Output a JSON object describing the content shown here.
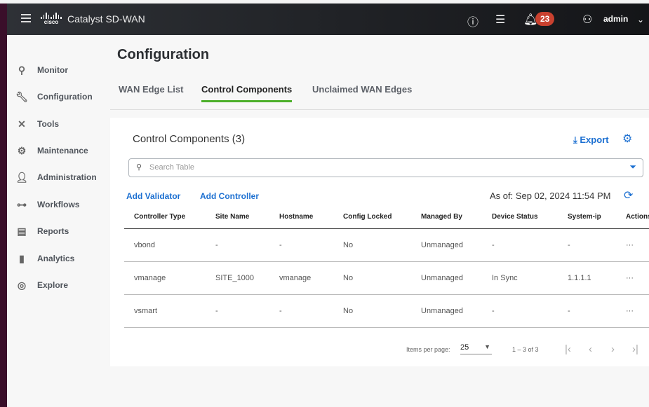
{
  "header": {
    "app_title": "Catalyst SD-WAN",
    "logo_text": "cisco",
    "notification_count": "23",
    "user": "admin"
  },
  "sidebar": {
    "items": [
      {
        "label": "Monitor",
        "icon": "monitor-icon"
      },
      {
        "label": "Configuration",
        "icon": "wrench-icon"
      },
      {
        "label": "Tools",
        "icon": "tools-icon"
      },
      {
        "label": "Maintenance",
        "icon": "maintenance-icon"
      },
      {
        "label": "Administration",
        "icon": "admin-icon"
      },
      {
        "label": "Workflows",
        "icon": "workflow-icon"
      },
      {
        "label": "Reports",
        "icon": "report-icon"
      },
      {
        "label": "Analytics",
        "icon": "analytics-icon"
      },
      {
        "label": "Explore",
        "icon": "compass-icon"
      }
    ]
  },
  "page": {
    "title": "Configuration",
    "tabs": [
      "WAN Edge List",
      "Control Components",
      "Unclaimed WAN Edges"
    ],
    "active_tab": "Control Components"
  },
  "card": {
    "title": "Control Components (3)",
    "export": "Export",
    "search_placeholder": "Search Table",
    "add_validator": "Add Validator",
    "add_controller": "Add Controller",
    "as_of": "As of: Sep 02, 2024 11:54 PM"
  },
  "table": {
    "columns": [
      "Controller Type",
      "Site Name",
      "Hostname",
      "Config Locked",
      "Managed By",
      "Device Status",
      "System-ip",
      "Actions"
    ],
    "rows": [
      [
        "vbond",
        "-",
        "-",
        "No",
        "Unmanaged",
        "-",
        "-",
        "···"
      ],
      [
        "vmanage",
        "SITE_1000",
        "vmanage",
        "No",
        "Unmanaged",
        "In Sync",
        "1.1.1.1",
        "···"
      ],
      [
        "vsmart",
        "-",
        "-",
        "No",
        "Unmanaged",
        "-",
        "-",
        "···"
      ]
    ]
  },
  "pagination": {
    "items_per_page_label": "Items per page:",
    "items_per_page": "25",
    "range": "1 – 3 of 3"
  },
  "colors": {
    "accent": "#1b6fd1",
    "active_tab": "#4caf2a",
    "badge": "#c9412f"
  }
}
